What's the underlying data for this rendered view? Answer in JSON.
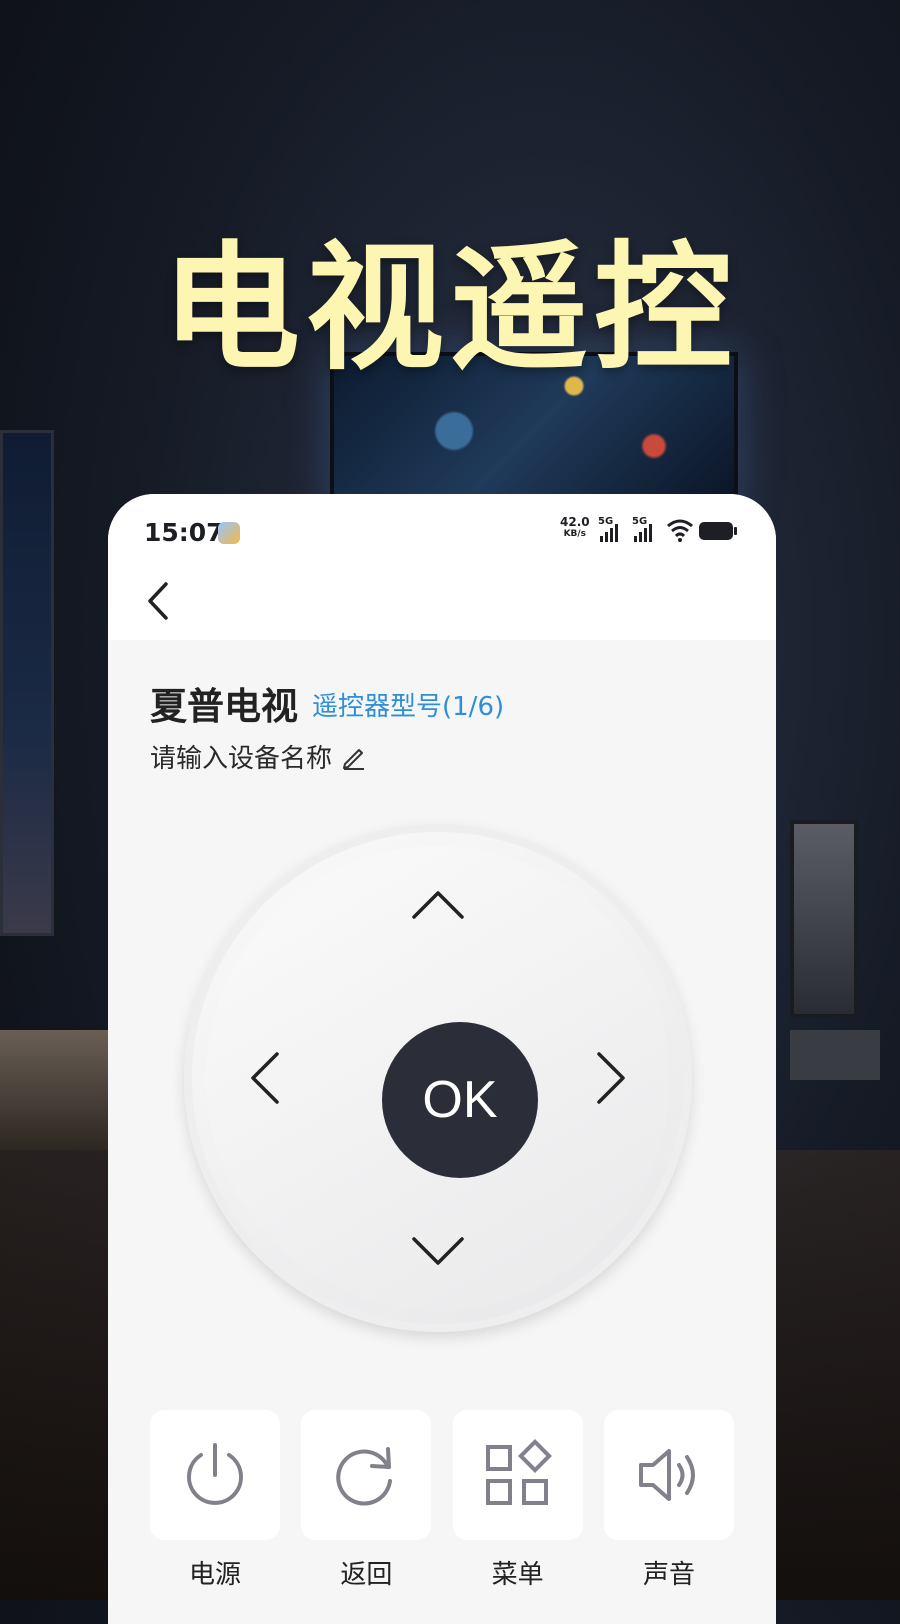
{
  "headline": "电视遥控",
  "status_bar": {
    "time": "15:07",
    "net_speed_value": "42.0",
    "net_speed_unit": "KB/s",
    "signal1_label": "5G",
    "signal2_label": "5G"
  },
  "device": {
    "title": "夏普电视",
    "model_link": "遥控器型号(1/6)",
    "name_placeholder": "请输入设备名称"
  },
  "dpad": {
    "ok_label": "OK"
  },
  "functions": [
    {
      "label": "电源",
      "icon": "power-icon"
    },
    {
      "label": "返回",
      "icon": "refresh-icon"
    },
    {
      "label": "菜单",
      "icon": "menu-grid-icon"
    },
    {
      "label": "声音",
      "icon": "volume-icon"
    }
  ],
  "colors": {
    "headline": "#fdf6b3",
    "accent_link": "#2f8ed6",
    "ok_button": "#2b2d39"
  }
}
